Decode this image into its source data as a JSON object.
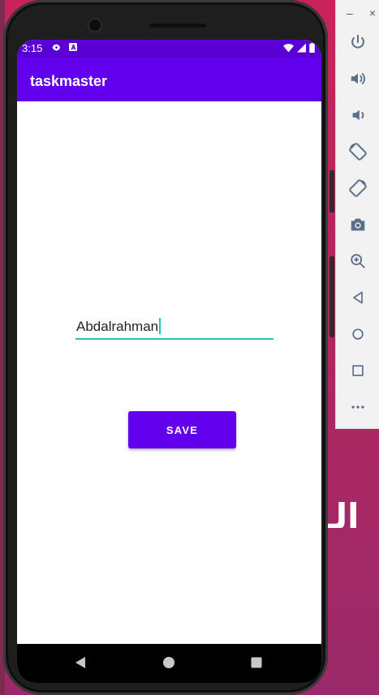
{
  "status_bar": {
    "time": "3:15",
    "left_icons": [
      "gear-icon",
      "a-icon"
    ],
    "right_icons": [
      "wifi-icon",
      "signal-icon",
      "battery-icon"
    ]
  },
  "app_bar": {
    "title": "taskmaster"
  },
  "main": {
    "text_field": {
      "value": "Abdalrahman"
    },
    "save_button": {
      "label": "SAVE"
    }
  },
  "navigation": {
    "buttons": [
      "back-icon",
      "home-icon",
      "recents-icon"
    ]
  },
  "emulator_toolbar": {
    "window_controls": [
      "minimize-icon",
      "close-icon"
    ],
    "buttons": [
      "power-icon",
      "volume-up-icon",
      "volume-down-icon",
      "rotate-left-icon",
      "rotate-right-icon",
      "screenshot-icon",
      "zoom-icon",
      "back-icon",
      "home-icon",
      "overview-icon",
      "more-icon"
    ]
  },
  "wallpaper": {
    "text": "الـ"
  },
  "colors": {
    "primary": "#6200ee",
    "status_bar": "#5a00d6",
    "accent": "#1fc7b6",
    "wallpaper": "#c8235a"
  }
}
